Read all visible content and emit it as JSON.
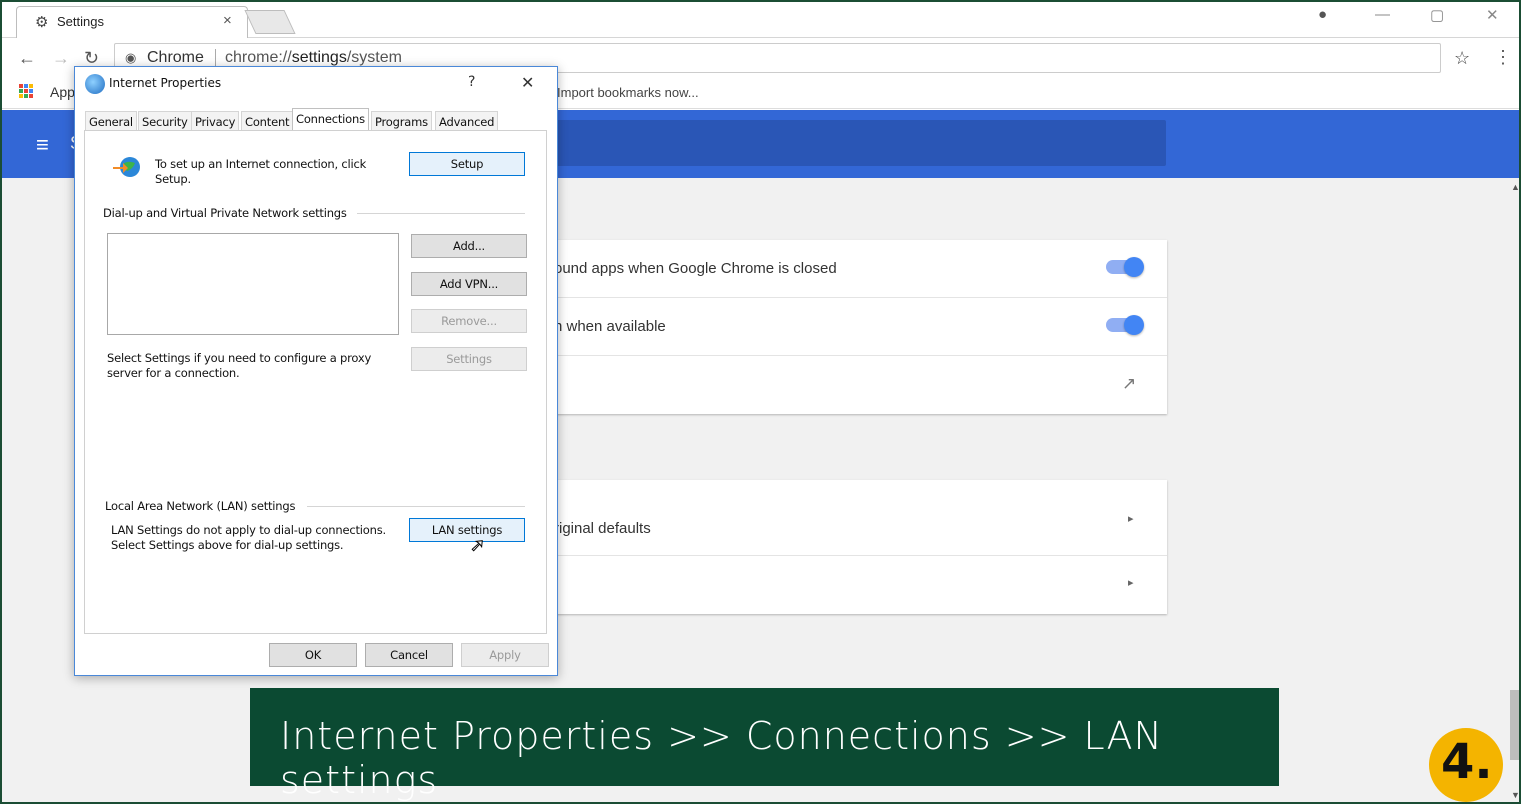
{
  "browser": {
    "tab_title": "Settings",
    "omnibox_site": "Chrome",
    "omnibox_url_prefix": "chrome://",
    "omnibox_url_path": "settings",
    "omnibox_url_suffix": "/system",
    "apps_label": "Apps",
    "import_bookmarks": "Import bookmarks now...",
    "header_partial": "S"
  },
  "settings_page": {
    "card1": [
      {
        "text": "Continue running background apps when Google Chrome is closed",
        "visible_text": "ound apps when Google Chrome is closed",
        "toggle": "on"
      },
      {
        "text": "Use hardware acceleration when available",
        "visible_text": "n when available",
        "toggle": "on"
      },
      {
        "text": "",
        "visible_text": "",
        "icon": "external-link-icon"
      }
    ],
    "card2": [
      {
        "text": "Restore settings to their original defaults",
        "visible_text": "riginal defaults"
      },
      {
        "text": "",
        "visible_text": ""
      }
    ]
  },
  "dialog": {
    "title": "Internet Properties",
    "help": "?",
    "close": "✕",
    "tabs": [
      "General",
      "Security",
      "Privacy",
      "Content",
      "Connections",
      "Programs",
      "Advanced"
    ],
    "active_tab": "Connections",
    "setup_text_line1": "To set up an Internet connection, click",
    "setup_text_line2": "Setup.",
    "setup_button": "Setup",
    "dialup_group": "Dial-up and Virtual Private Network settings",
    "add_button": "Add...",
    "add_vpn_button": "Add VPN...",
    "remove_button": "Remove...",
    "settings_button": "Settings",
    "proxy_text_line1": "Select Settings if you need to configure a proxy",
    "proxy_text_line2": "server for a connection.",
    "lan_group": "Local Area Network (LAN) settings",
    "lan_text_line1": "LAN Settings do not apply to dial-up connections.",
    "lan_text_line2": "Select Settings above for dial-up settings.",
    "lan_button": "LAN settings",
    "ok_button": "OK",
    "cancel_button": "Cancel",
    "apply_button": "Apply"
  },
  "caption": {
    "text": "Internet Properties >> Connections >> LAN settings",
    "step": "4."
  },
  "colors": {
    "chrome_blue": "#3367d6",
    "caption_green": "#0b4a32",
    "badge_yellow": "#f4b400",
    "toggle_blue": "#4285f4"
  }
}
